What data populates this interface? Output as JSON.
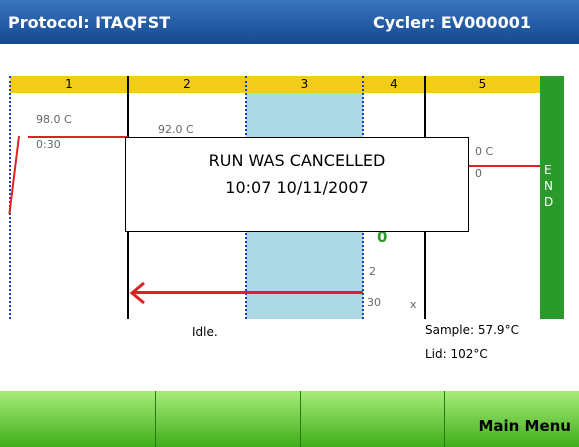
{
  "header": {
    "protocol": "Protocol: ITAQFST",
    "cycler": "Cycler: EV000001"
  },
  "stages": [
    "1",
    "2",
    "3",
    "4",
    "5"
  ],
  "end_label": [
    "E",
    "N",
    "D"
  ],
  "steps": {
    "s1_temp": "98.0 C",
    "s1_time": "0:30",
    "s2_temp": "92.0 C",
    "s5_temp": "0 C",
    "s5_time": "0",
    "cycle_digit": "0",
    "goto_step": "2",
    "cycles": "30",
    "x_mark": "x"
  },
  "dialog": {
    "line1": "RUN WAS CANCELLED",
    "line2": "10:07 10/11/2007"
  },
  "status": {
    "idle": "Idle.",
    "sample": "Sample: 57.9°C",
    "lid": "Lid: 102°C"
  },
  "footer": {
    "button1": "",
    "button2": "",
    "button3": "",
    "main_menu": "Main Menu"
  },
  "colors": {
    "header": "#1f5aa6",
    "stage_bar": "#f2cc1a",
    "end_col": "#2a9a2a",
    "shade": "#add8e6",
    "arrow": "#dd2222"
  }
}
